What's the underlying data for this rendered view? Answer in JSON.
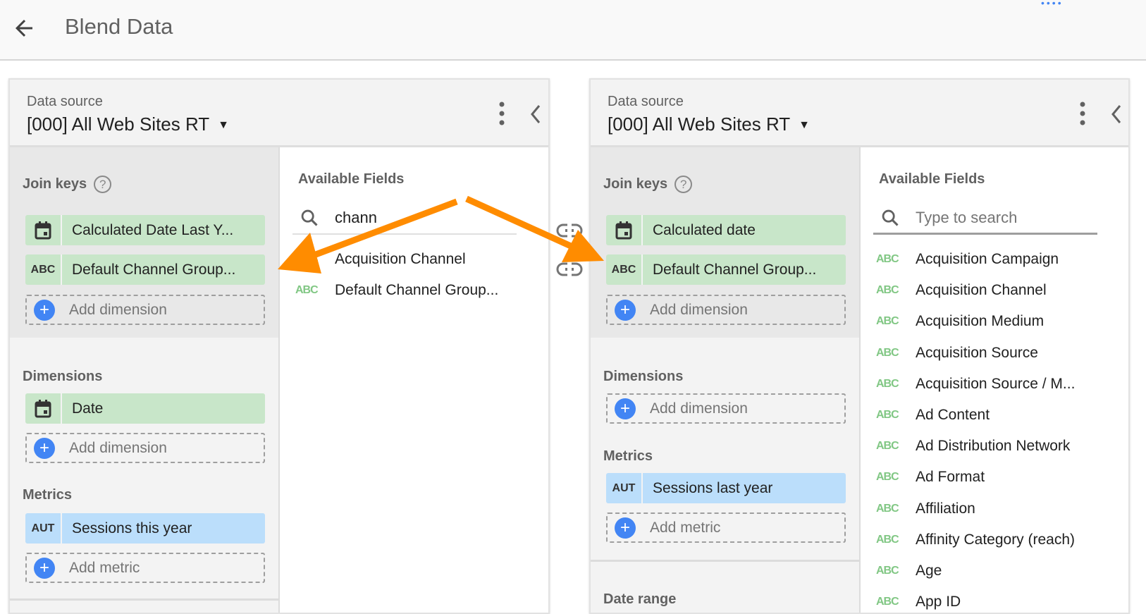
{
  "header": {
    "title": "Blend Data",
    "back_icon": "arrow-left-icon",
    "menu_icon": "more-dots-icon"
  },
  "accent_color": "#4285f4",
  "annotation_color": "#ff8c00",
  "left": {
    "data_source_label": "Data source",
    "data_source": "[000] All Web Sites RT",
    "join_keys_label": "Join keys",
    "join_keys": [
      {
        "type": "DATE",
        "label": "Calculated Date Last Y..."
      },
      {
        "type": "ABC",
        "label": "Default Channel Group..."
      }
    ],
    "add_dimension": "Add dimension",
    "dimensions_label": "Dimensions",
    "dimensions": [
      {
        "type": "DATE",
        "label": "Date"
      }
    ],
    "metrics_label": "Metrics",
    "metrics": [
      {
        "type": "AUT",
        "label": "Sessions this year"
      }
    ],
    "add_metric": "Add metric",
    "available_label": "Available Fields",
    "search_value": "chann",
    "fields": [
      {
        "type": "ABC",
        "label": "Acquisition Channel"
      },
      {
        "type": "ABC",
        "label": "Default Channel Group..."
      }
    ]
  },
  "right": {
    "data_source_label": "Data source",
    "data_source": "[000] All Web Sites RT",
    "join_keys_label": "Join keys",
    "join_keys": [
      {
        "type": "DATE",
        "label": "Calculated date"
      },
      {
        "type": "ABC",
        "label": "Default Channel Group..."
      }
    ],
    "add_dimension": "Add dimension",
    "dimensions_label": "Dimensions",
    "metrics_label": "Metrics",
    "metrics": [
      {
        "type": "AUT",
        "label": "Sessions last year"
      }
    ],
    "add_metric": "Add metric",
    "date_range_label": "Date range",
    "available_label": "Available Fields",
    "search_placeholder": "Type to search",
    "fields": [
      {
        "type": "ABC",
        "label": "Acquisition Campaign"
      },
      {
        "type": "ABC",
        "label": "Acquisition Channel"
      },
      {
        "type": "ABC",
        "label": "Acquisition Medium"
      },
      {
        "type": "ABC",
        "label": "Acquisition Source"
      },
      {
        "type": "ABC",
        "label": "Acquisition Source / M..."
      },
      {
        "type": "ABC",
        "label": "Ad Content"
      },
      {
        "type": "ABC",
        "label": "Ad Distribution Network"
      },
      {
        "type": "ABC",
        "label": "Ad Format"
      },
      {
        "type": "ABC",
        "label": "Affiliation"
      },
      {
        "type": "ABC",
        "label": "Affinity Category (reach)"
      },
      {
        "type": "ABC",
        "label": "Age"
      },
      {
        "type": "ABC",
        "label": "App ID"
      }
    ]
  }
}
